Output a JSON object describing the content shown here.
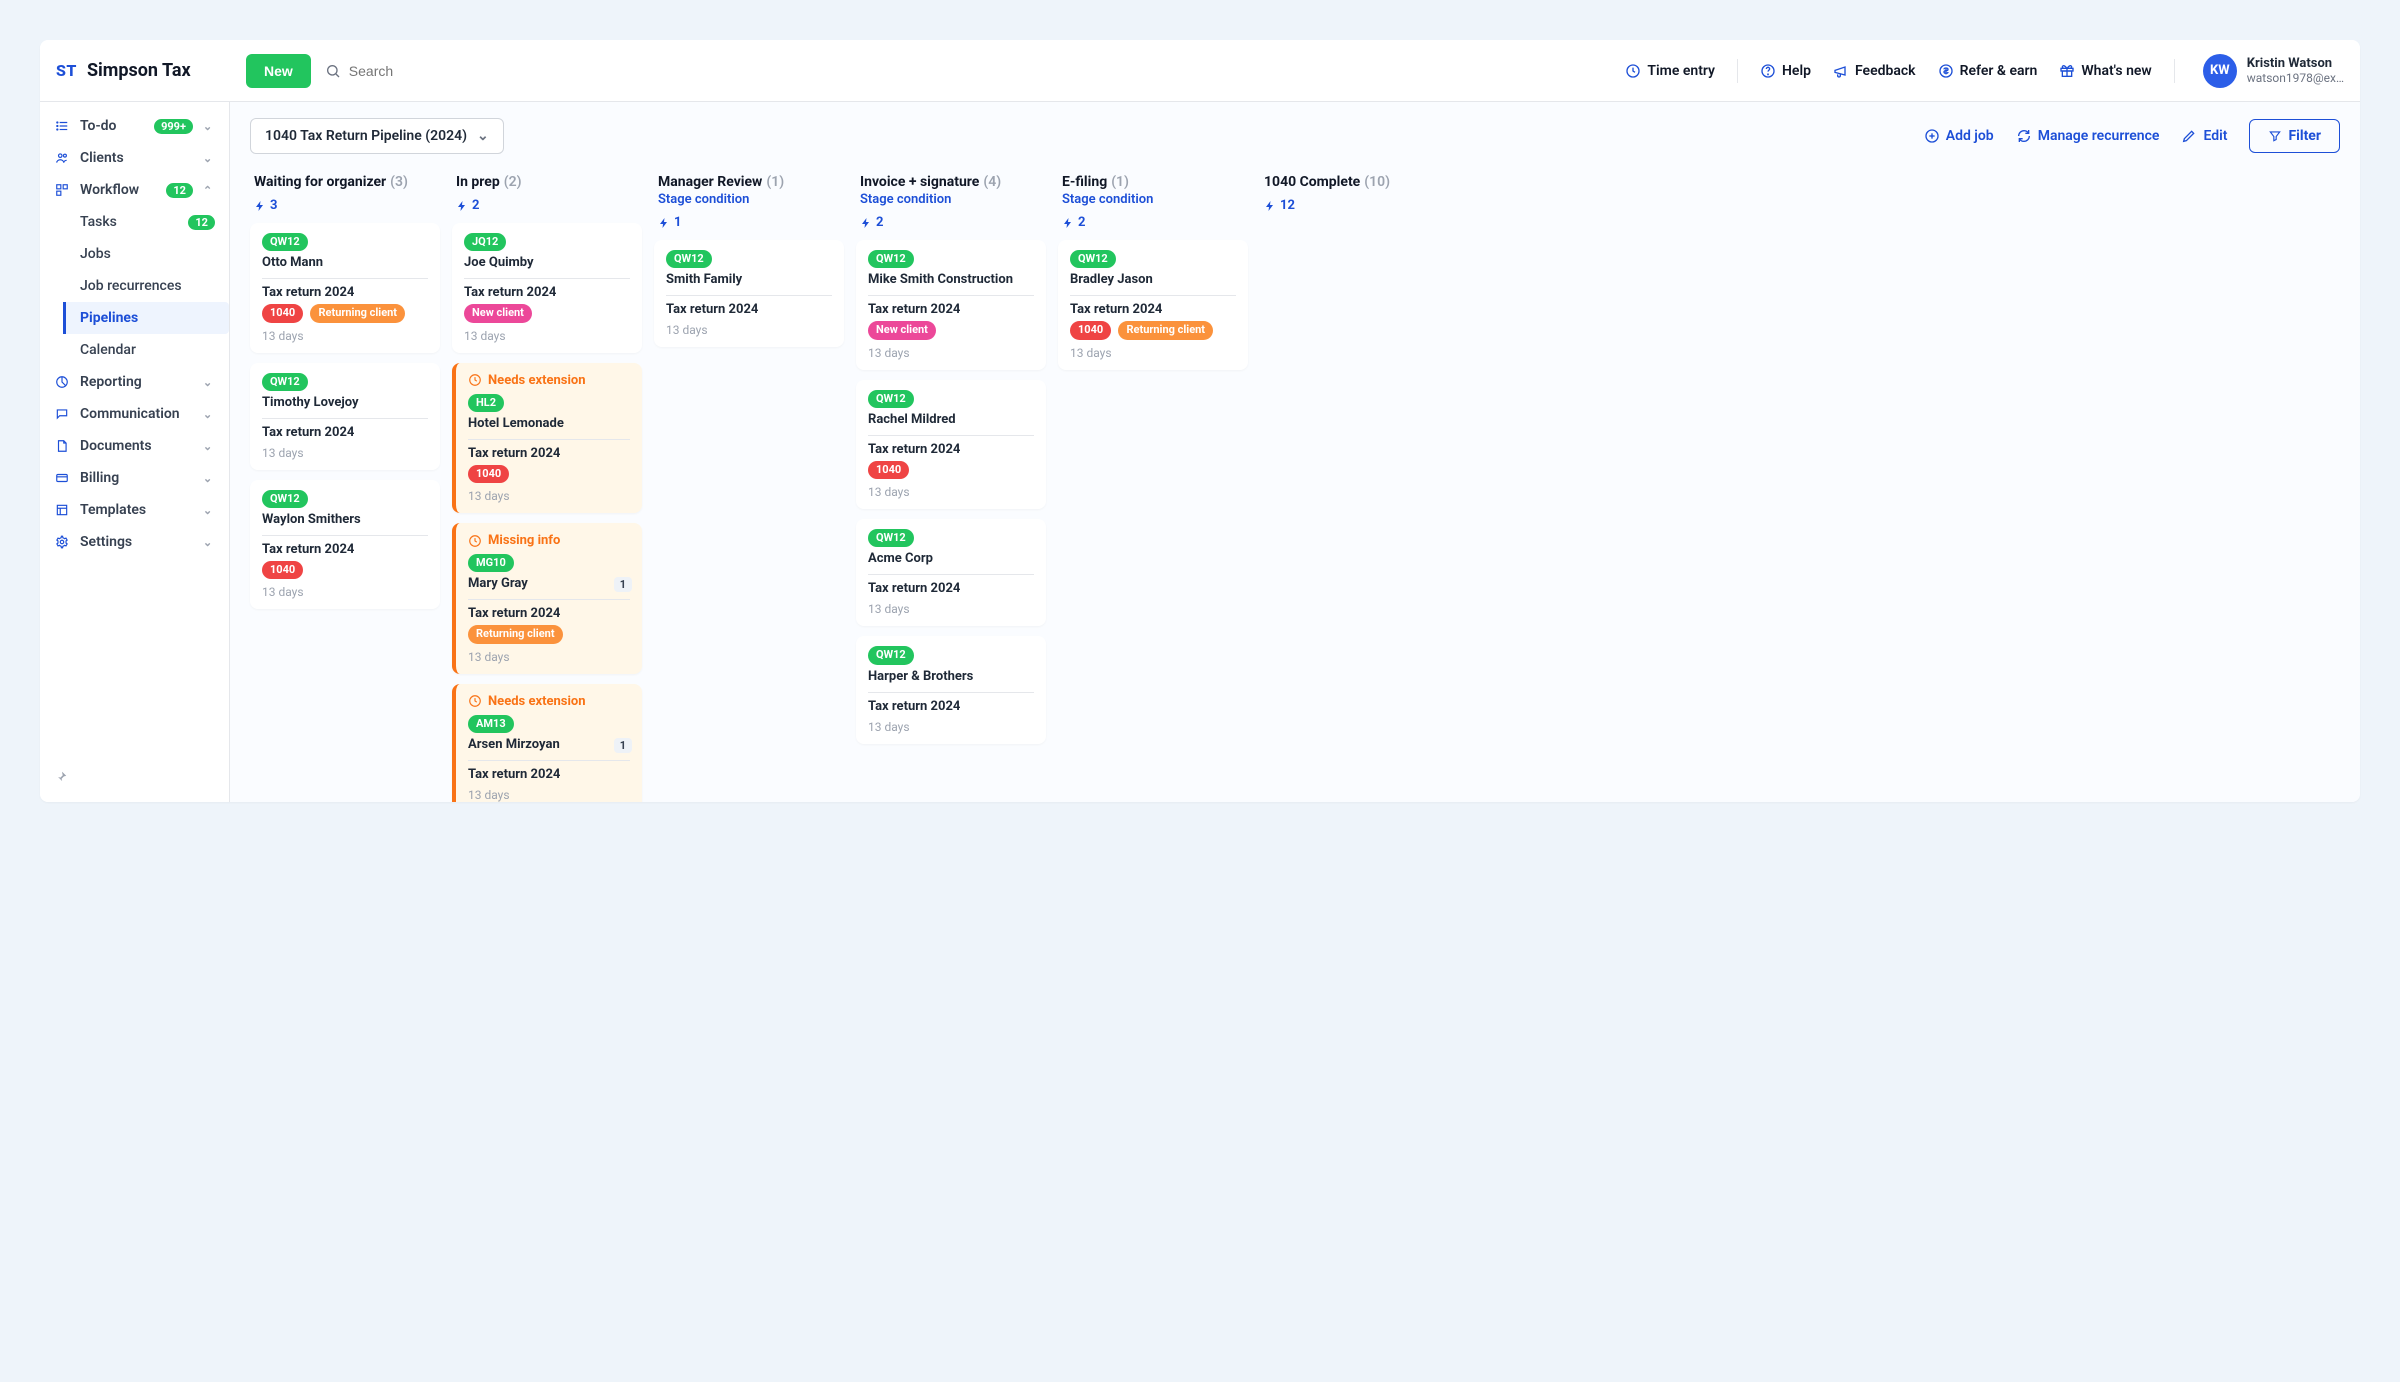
{
  "brand": {
    "badge": "ST",
    "name": "Simpson Tax"
  },
  "header": {
    "new_label": "New",
    "search_placeholder": "Search",
    "actions": {
      "time_entry": "Time entry",
      "help": "Help",
      "feedback": "Feedback",
      "refer": "Refer & earn",
      "whats_new": "What's new"
    },
    "user": {
      "initials": "KW",
      "name": "Kristin Watson",
      "email": "watson1978@ex…"
    }
  },
  "sidebar": {
    "todo": {
      "label": "To-do",
      "badge": "999+"
    },
    "clients": {
      "label": "Clients"
    },
    "workflow": {
      "label": "Workflow",
      "badge": "12"
    },
    "workflow_children": {
      "tasks": {
        "label": "Tasks",
        "badge": "12"
      },
      "jobs": {
        "label": "Jobs"
      },
      "recurrences": {
        "label": "Job recurrences"
      },
      "pipelines": {
        "label": "Pipelines"
      },
      "calendar": {
        "label": "Calendar"
      }
    },
    "reporting": {
      "label": "Reporting"
    },
    "communication": {
      "label": "Communication"
    },
    "documents": {
      "label": "Documents"
    },
    "billing": {
      "label": "Billing"
    },
    "templates": {
      "label": "Templates"
    },
    "settings": {
      "label": "Settings"
    }
  },
  "toolbar": {
    "pipeline_select": "1040 Tax Return Pipeline (2024)",
    "add_job": "Add job",
    "manage_recurrence": "Manage recurrence",
    "edit": "Edit",
    "filter": "Filter"
  },
  "common": {
    "stage_condition": "Stage condition",
    "job_title": "Tax return 2024",
    "days": "13 days",
    "tags": {
      "t1040": "1040",
      "returning": "Returning client",
      "new_client": "New client"
    },
    "warnings": {
      "needs_extension": "Needs extension",
      "missing_info": "Missing info"
    }
  },
  "columns": [
    {
      "title": "Waiting for organizer",
      "count": "(3)",
      "auto": "3",
      "has_stage_cond": false
    },
    {
      "title": "In prep",
      "count": "(2)",
      "auto": "2",
      "has_stage_cond": false
    },
    {
      "title": "Manager Review",
      "count": "(1)",
      "auto": "1",
      "has_stage_cond": true
    },
    {
      "title": "Invoice + signature",
      "count": "(4)",
      "auto": "2",
      "has_stage_cond": true
    },
    {
      "title": "E-filing",
      "count": "(1)",
      "auto": "2",
      "has_stage_cond": true
    },
    {
      "title": "1040 Complete",
      "count": "(10)",
      "auto": "12",
      "has_stage_cond": false
    }
  ],
  "cards": {
    "c0_0": {
      "chip": "QW12",
      "client": "Otto Mann"
    },
    "c0_1": {
      "chip": "QW12",
      "client": "Timothy Lovejoy"
    },
    "c0_2": {
      "chip": "QW12",
      "client": "Waylon Smithers"
    },
    "c1_0": {
      "chip": "JQ12",
      "client": "Joe Quimby"
    },
    "c1_1": {
      "chip": "HL2",
      "client": "Hotel Lemonade"
    },
    "c1_2": {
      "chip": "MG10",
      "client": "Mary Gray",
      "num": "1"
    },
    "c1_3": {
      "chip": "AM13",
      "client": "Arsen Mirzoyan",
      "num": "1"
    },
    "c2_0": {
      "chip": "QW12",
      "client": "Smith Family"
    },
    "c3_0": {
      "chip": "QW12",
      "client": "Mike Smith Construction"
    },
    "c3_1": {
      "chip": "QW12",
      "client": "Rachel Mildred"
    },
    "c3_2": {
      "chip": "QW12",
      "client": "Acme Corp"
    },
    "c3_3": {
      "chip": "QW12",
      "client": "Harper & Brothers"
    },
    "c4_0": {
      "chip": "QW12",
      "client": "Bradley Jason"
    }
  }
}
